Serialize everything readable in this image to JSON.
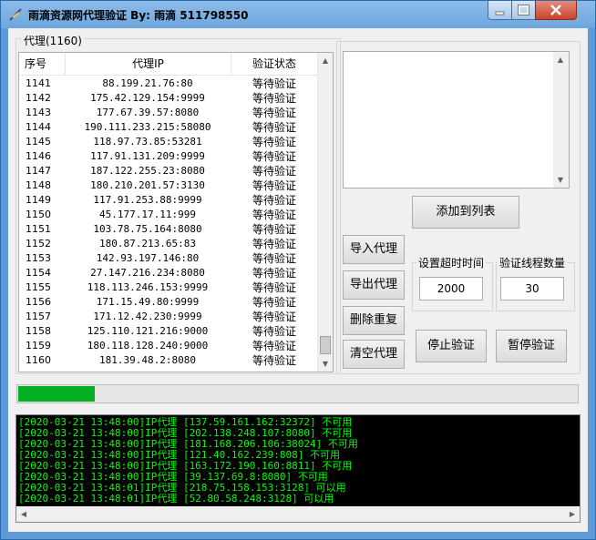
{
  "window": {
    "title": "雨滴资源网代理验证 By: 雨滴 511798550"
  },
  "proxy_group": {
    "label": "代理(1160)",
    "columns": [
      "序号",
      "代理IP",
      "验证状态"
    ],
    "rows": [
      {
        "id": "1141",
        "ip": "88.199.21.76:80",
        "status": "等待验证"
      },
      {
        "id": "1142",
        "ip": "175.42.129.154:9999",
        "status": "等待验证"
      },
      {
        "id": "1143",
        "ip": "177.67.39.57:8080",
        "status": "等待验证"
      },
      {
        "id": "1144",
        "ip": "190.111.233.215:58080",
        "status": "等待验证"
      },
      {
        "id": "1145",
        "ip": "118.97.73.85:53281",
        "status": "等待验证"
      },
      {
        "id": "1146",
        "ip": "117.91.131.209:9999",
        "status": "等待验证"
      },
      {
        "id": "1147",
        "ip": "187.122.255.23:8080",
        "status": "等待验证"
      },
      {
        "id": "1148",
        "ip": "180.210.201.57:3130",
        "status": "等待验证"
      },
      {
        "id": "1149",
        "ip": "117.91.253.88:9999",
        "status": "等待验证"
      },
      {
        "id": "1150",
        "ip": "45.177.17.11:999",
        "status": "等待验证"
      },
      {
        "id": "1151",
        "ip": "103.78.75.164:8080",
        "status": "等待验证"
      },
      {
        "id": "1152",
        "ip": "180.87.213.65:83",
        "status": "等待验证"
      },
      {
        "id": "1153",
        "ip": "142.93.197.146:80",
        "status": "等待验证"
      },
      {
        "id": "1154",
        "ip": "27.147.216.234:8080",
        "status": "等待验证"
      },
      {
        "id": "1155",
        "ip": "118.113.246.153:9999",
        "status": "等待验证"
      },
      {
        "id": "1156",
        "ip": "171.15.49.80:9999",
        "status": "等待验证"
      },
      {
        "id": "1157",
        "ip": "171.12.42.230:9999",
        "status": "等待验证"
      },
      {
        "id": "1158",
        "ip": "125.110.121.216:9000",
        "status": "等待验证"
      },
      {
        "id": "1159",
        "ip": "180.118.128.240:9000",
        "status": "等待验证"
      },
      {
        "id": "1160",
        "ip": "181.39.48.2:8080",
        "status": "等待验证"
      }
    ]
  },
  "buttons": {
    "add_to_list": "添加到列表",
    "import": "导入代理",
    "export": "导出代理",
    "dedupe": "删除重复",
    "clear": "清空代理",
    "stop": "停止验证",
    "pause": "暂停验证"
  },
  "settings": {
    "timeout_label": "设置超时时间",
    "timeout_value": "2000",
    "threads_label": "验证线程数量",
    "threads_value": "30"
  },
  "progress": {
    "fraction": 0.137,
    "color": "#06b025"
  },
  "log": {
    "color": "#00ff00",
    "lines": [
      "[2020-03-21 13:48:00]IP代理 [137.59.161.162:32372] 不可用",
      "[2020-03-21 13:48:00]IP代理 [202.138.248.107:8080] 不可用",
      "[2020-03-21 13:48:00]IP代理 [181.168.206.106:38024] 不可用",
      "[2020-03-21 13:48:00]IP代理 [121.40.162.239:808] 不可用",
      "[2020-03-21 13:48:00]IP代理 [163.172.190.160:8811] 不可用",
      "[2020-03-21 13:48:00]IP代理 [39.137.69.8:8080] 不可用",
      "[2020-03-21 13:48:01]IP代理 [218.75.158.153:3128] 可以用",
      "[2020-03-21 13:48:01]IP代理 [52.80.58.248:3128] 可以用"
    ]
  }
}
